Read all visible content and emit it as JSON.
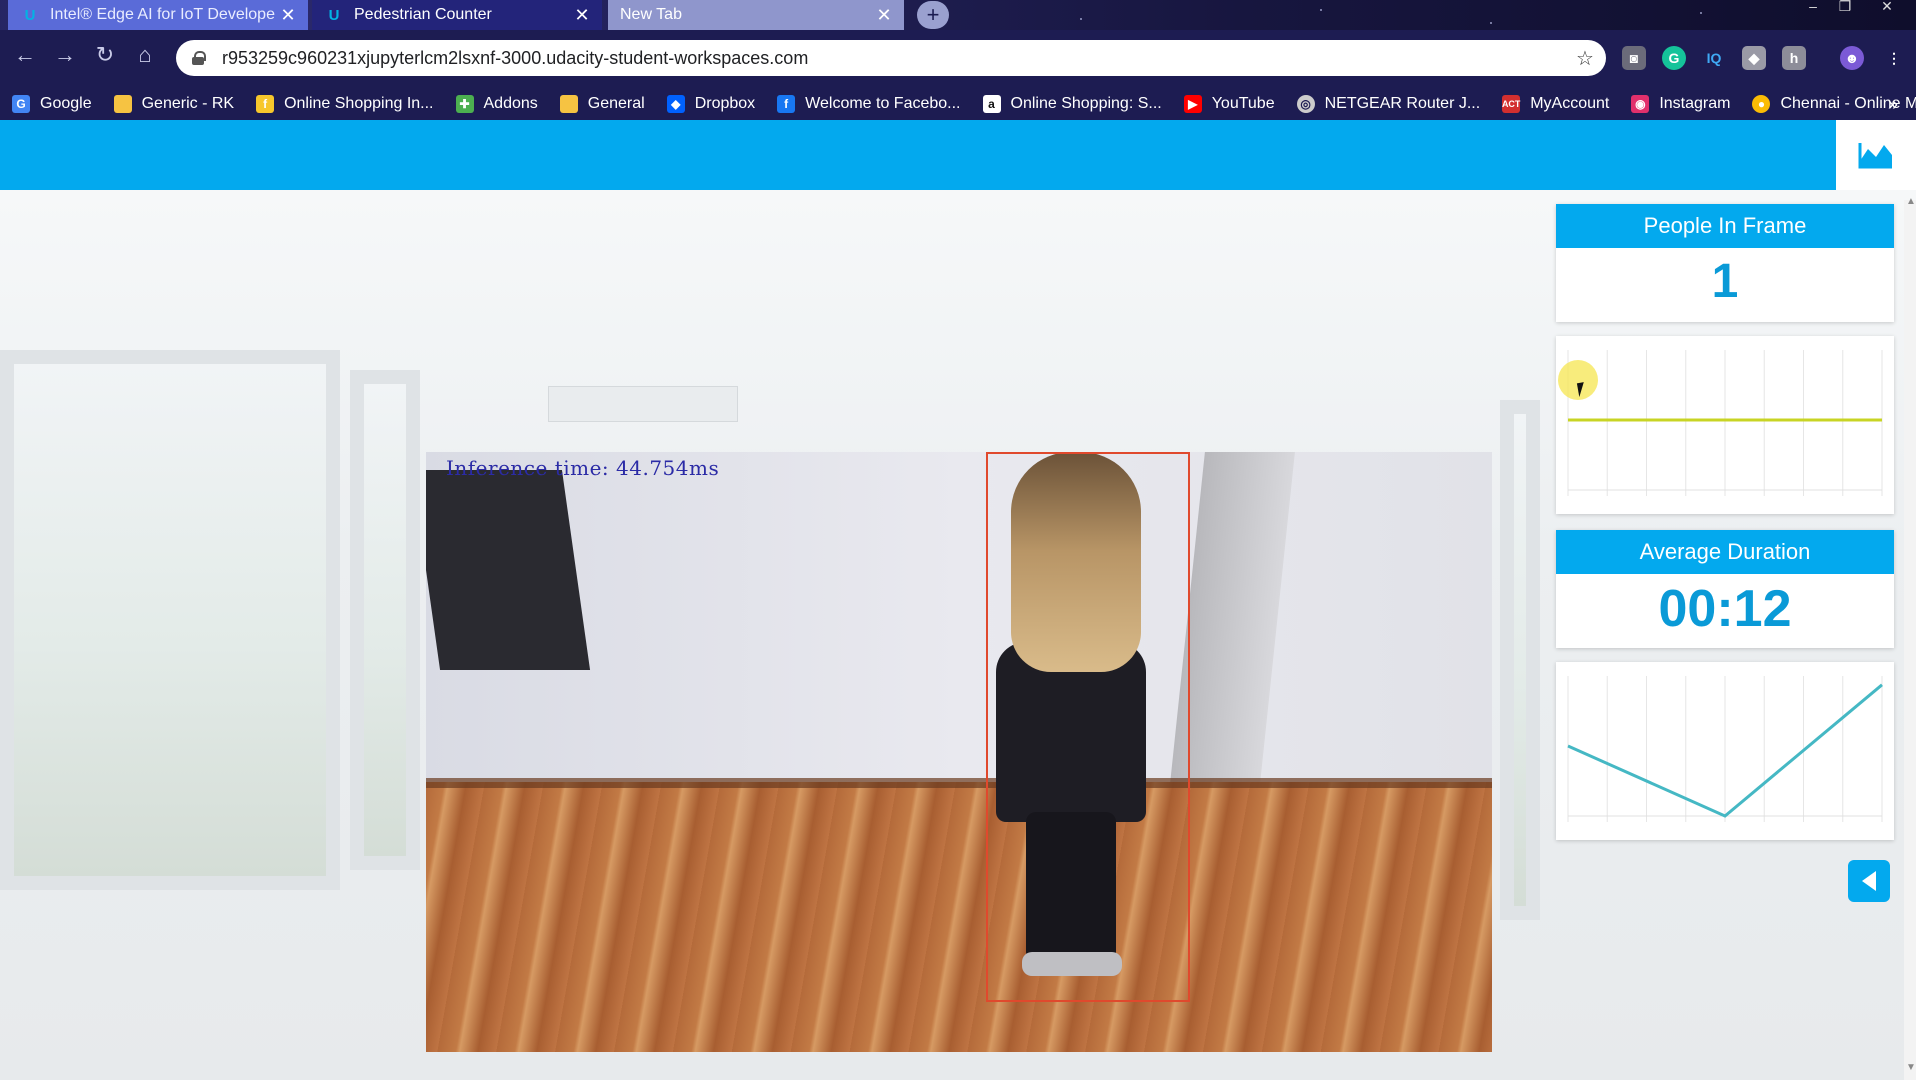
{
  "browser": {
    "tabs": [
      {
        "title": "Intel® Edge AI for IoT Developer",
        "favicon": "udacity-icon",
        "active": false
      },
      {
        "title": "Pedestrian Counter",
        "favicon": "udacity-icon",
        "active": true
      },
      {
        "title": "New Tab",
        "favicon": "",
        "active": false
      }
    ],
    "url": "r953259c960231xjupyterlcm2lsxnf-3000.udacity-student-workspaces.com",
    "bookmarks": [
      {
        "label": "Google",
        "icon": "google-icon",
        "color": "#4285f4"
      },
      {
        "label": "Generic - RK",
        "icon": "folder-icon",
        "color": "#f6c342"
      },
      {
        "label": "Online Shopping In...",
        "icon": "flipkart-icon",
        "color": "#f7c72c"
      },
      {
        "label": "Addons",
        "icon": "puzzle-icon",
        "color": "#4caf50"
      },
      {
        "label": "General",
        "icon": "folder-icon",
        "color": "#f6c342"
      },
      {
        "label": "Dropbox",
        "icon": "dropbox-icon",
        "color": "#0061fe"
      },
      {
        "label": "Welcome to Facebo...",
        "icon": "facebook-icon",
        "color": "#1877f2"
      },
      {
        "label": "Online Shopping: S...",
        "icon": "amazon-icon",
        "color": "#222222"
      },
      {
        "label": "YouTube",
        "icon": "youtube-icon",
        "color": "#ff0000"
      },
      {
        "label": "NETGEAR Router J...",
        "icon": "globe-icon",
        "color": "#cccccc"
      },
      {
        "label": "MyAccount",
        "icon": "act-icon",
        "color": "#d32f2f"
      },
      {
        "label": "Instagram",
        "icon": "instagram-icon",
        "color": "#e1306c"
      },
      {
        "label": "Chennai - Online M...",
        "icon": "chrome-icon",
        "color": "#fbbc05"
      }
    ],
    "bookmarks_more": "»"
  },
  "video": {
    "inference_text": "Inference time: 44.754ms",
    "detection_box": "red"
  },
  "stats": {
    "people_in_frame": {
      "title": "People In Frame",
      "value": "1"
    },
    "average_duration": {
      "title": "Average Duration",
      "value": "00:12"
    }
  },
  "chart_data": [
    {
      "type": "line",
      "series": [
        {
          "values": [
            1,
            1,
            1,
            1,
            1,
            1,
            1
          ]
        }
      ],
      "color": "#c8d424",
      "grid": true
    },
    {
      "type": "line",
      "series": [
        {
          "values": [
            8,
            0,
            15
          ]
        }
      ],
      "color": "#45b8c4",
      "grid": true
    }
  ],
  "colors": {
    "accent": "#03a9ee",
    "value_text": "#0a9ad7"
  }
}
